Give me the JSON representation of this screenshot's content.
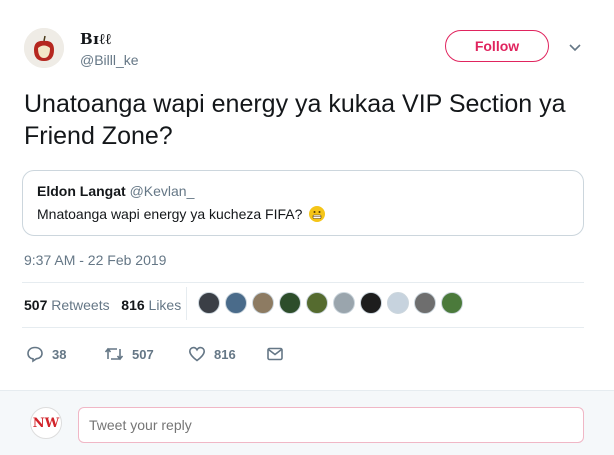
{
  "author": {
    "name": "Bɪℓℓ",
    "handle": "@Billl_ke"
  },
  "follow_label": "Follow",
  "tweet_text": "Unatoanga wapi energy ya kukaa VIP Section ya Friend Zone?",
  "quote": {
    "name": "Eldon Langat",
    "handle": "@Kevlan_",
    "text": "Mnatoanga wapi energy ya kucheza FIFA?"
  },
  "timestamp": "9:37 AM - 22 Feb 2019",
  "stats": {
    "retweets_count": "507",
    "retweets_label": "Retweets",
    "likes_count": "816",
    "likes_label": "Likes"
  },
  "actions": {
    "replies": "38",
    "retweets": "507",
    "likes": "816"
  },
  "reply": {
    "placeholder": "Tweet your reply",
    "avatar_text": "NW"
  },
  "colors": {
    "accent": "#e0245e",
    "muted": "#657786"
  }
}
